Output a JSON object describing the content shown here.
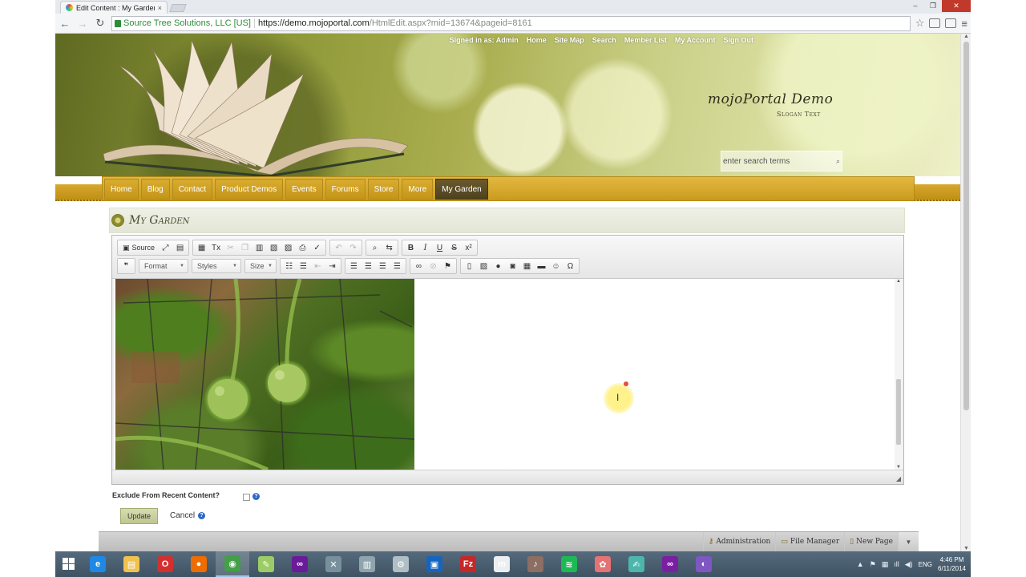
{
  "browser": {
    "tab_title": "Edit Content : My Garden",
    "tab_close": "×",
    "back": "←",
    "forward": "→",
    "reload": "↻",
    "cert_name": "Source Tree Solutions, LLC [US]",
    "url_host": "https://demo.mojoportal.com",
    "url_path": "/HtmlEdit.aspx?mid=13674&pageid=8161",
    "star": "☆",
    "menu": "≡",
    "win_min": "–",
    "win_max": "❐",
    "win_close": "✕"
  },
  "header": {
    "topnav": [
      "Signed in as: Admin",
      "Home",
      "Site Map",
      "Search",
      "Member List",
      "My Account",
      "Sign Out"
    ],
    "site_title": "mojoPortal Demo",
    "slogan": "Slogan Text",
    "search_placeholder": "enter search terms",
    "search_icon": "🔍"
  },
  "menu": {
    "items": [
      "Home",
      "Blog",
      "Contact",
      "Product Demos",
      "Events",
      "Forums",
      "Store",
      "More",
      "My Garden"
    ],
    "active": "My Garden"
  },
  "module": {
    "title": "My Garden"
  },
  "editor": {
    "source_label": "Source",
    "format_label": "Format",
    "styles_label": "Styles",
    "size_label": "Size",
    "bold": "B",
    "italic": "I",
    "underline": "U",
    "strike": "S",
    "superscript": "x²",
    "remove_format": "Tx",
    "blockquote": "❞",
    "omega": "Ω",
    "image_alt": "Tomato plants in garden"
  },
  "form": {
    "exclude_label": "Exclude From Recent Content?",
    "help": "?",
    "update_label": "Update",
    "cancel_label": "Cancel"
  },
  "admin_bar": {
    "items": [
      "Administration",
      "File Manager",
      "New Page"
    ]
  },
  "taskbar": {
    "lang": "ENG",
    "time": "4:46 PM",
    "date": "6/11/2014",
    "apps": [
      {
        "name": "ie-icon",
        "color": "#1e88e5",
        "glyph": "e"
      },
      {
        "name": "file-explorer-icon",
        "color": "#f2c14e",
        "glyph": "▤"
      },
      {
        "name": "opera-icon",
        "color": "#d32f2f",
        "glyph": "O"
      },
      {
        "name": "firefox-icon",
        "color": "#ef6c00",
        "glyph": "●"
      },
      {
        "name": "chrome-icon",
        "color": "#43a047",
        "glyph": "◉"
      },
      {
        "name": "notepad-icon",
        "color": "#9ccc65",
        "glyph": "✎"
      },
      {
        "name": "visual-studio-icon",
        "color": "#6a1b9a",
        "glyph": "∞"
      },
      {
        "name": "tools-icon",
        "color": "#78909c",
        "glyph": "✕"
      },
      {
        "name": "sql-icon",
        "color": "#90a4ae",
        "glyph": "▥"
      },
      {
        "name": "settings-icon",
        "color": "#b0bec5",
        "glyph": "⚙"
      },
      {
        "name": "network-icon",
        "color": "#1565c0",
        "glyph": "▣"
      },
      {
        "name": "filezilla-icon",
        "color": "#c62828",
        "glyph": "Fz"
      },
      {
        "name": "maps-icon",
        "color": "#eceff1",
        "glyph": "m"
      },
      {
        "name": "media-icon",
        "color": "#8d6e63",
        "glyph": "♪"
      },
      {
        "name": "spotify-icon",
        "color": "#1db954",
        "glyph": "≋"
      },
      {
        "name": "paint-icon",
        "color": "#e57373",
        "glyph": "✿"
      },
      {
        "name": "draw-icon",
        "color": "#4db6ac",
        "glyph": "✍"
      },
      {
        "name": "vs-icon",
        "color": "#7b1fa2",
        "glyph": "∞"
      },
      {
        "name": "remote-icon",
        "color": "#7e57c2",
        "glyph": "◐"
      }
    ]
  },
  "colors": {
    "menu_gold": "#d3a52a",
    "menu_active": "#574a24",
    "title_bar": "#e7e9dc",
    "update_button": "#c9d09e",
    "taskbar": "#4a5f70"
  }
}
